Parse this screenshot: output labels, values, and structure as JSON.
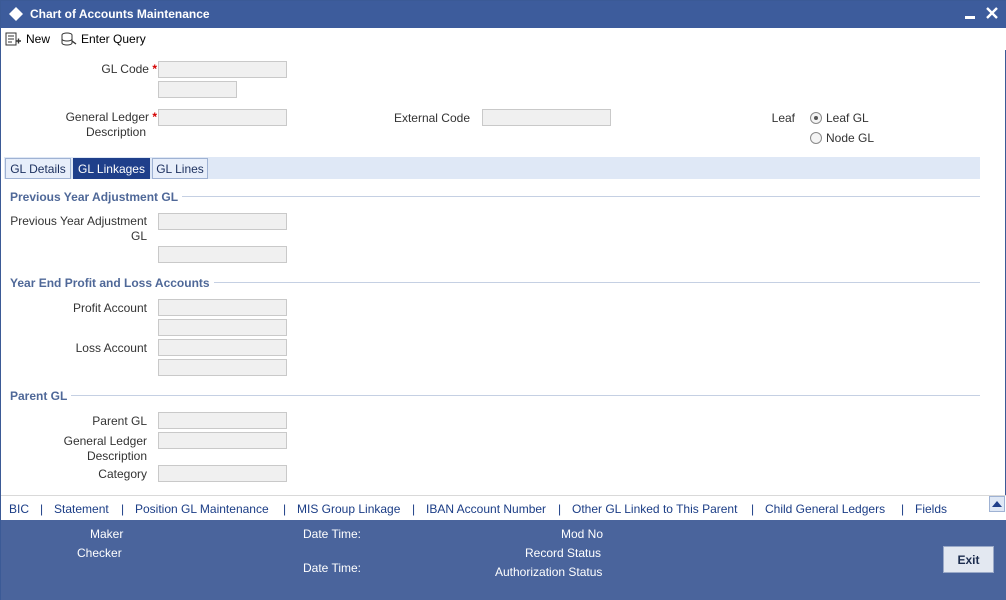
{
  "window": {
    "title": "Chart of Accounts Maintenance"
  },
  "toolbar": {
    "new_label": "New",
    "enter_query_label": "Enter Query"
  },
  "header_fields": {
    "gl_code_label": "GL Code",
    "required_mark": "*",
    "gl_code_value": "",
    "gl_code_secondary_value": "",
    "gl_desc_label_line1": "General Ledger",
    "gl_desc_label_line2": "Description",
    "gl_desc_value": "",
    "external_code_label": "External Code",
    "external_code_value": "",
    "leaf_label": "Leaf",
    "leaf_options": [
      "Leaf GL",
      "Node GL"
    ],
    "leaf_selected": "Leaf GL"
  },
  "tabs": [
    {
      "label": "GL Details",
      "active": false
    },
    {
      "label": "GL Linkages",
      "active": true
    },
    {
      "label": "GL Lines",
      "active": false
    }
  ],
  "prev_year": {
    "section_title": "Previous Year Adjustment GL",
    "field_label_line1": "Previous Year Adjustment",
    "field_label_line2": "GL",
    "value": "",
    "desc_value": ""
  },
  "year_end": {
    "section_title": "Year End Profit and Loss Accounts",
    "profit_label": "Profit Account",
    "profit_value": "",
    "profit_desc_value": "",
    "loss_label": "Loss Account",
    "loss_value": "",
    "loss_desc_value": ""
  },
  "parent_gl": {
    "section_title": "Parent GL",
    "parent_label": "Parent GL",
    "parent_value": "",
    "desc_label_line1": "General Ledger",
    "desc_label_line2": "Description",
    "desc_value": "",
    "category_label": "Category",
    "category_value": ""
  },
  "bottom_links": {
    "separator": "|",
    "items": [
      "BIC",
      "Statement",
      "Position GL Maintenance",
      "MIS Group Linkage",
      "IBAN Account Number",
      "Other GL Linked to This Parent",
      "Child General Ledgers",
      "Fields"
    ]
  },
  "footer": {
    "maker_label": "Maker",
    "checker_label": "Checker",
    "date_time_label": "Date Time:",
    "mod_no_label": "Mod No",
    "record_status_label": "Record Status",
    "authorization_status_label": "Authorization Status",
    "exit_label": "Exit"
  },
  "colors": {
    "title_bar": "#3d5c9c",
    "active_tab": "#1f3f8a",
    "section_title": "#4f6898",
    "footer": "#4a649c",
    "link": "#1b3d86"
  }
}
